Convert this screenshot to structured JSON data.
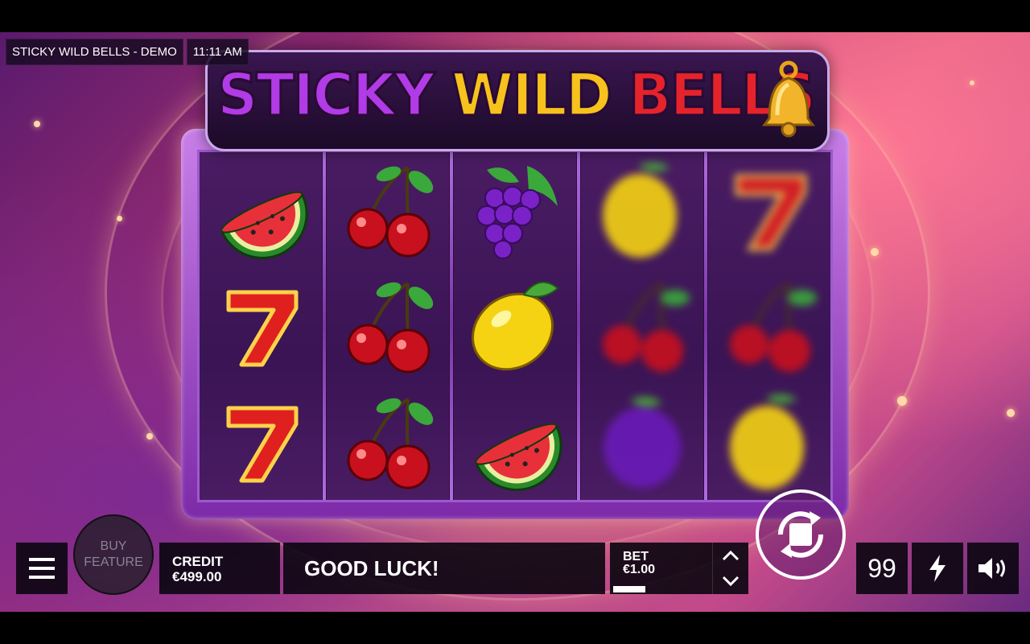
{
  "header": {
    "game_title": "STICKY WILD BELLS - DEMO",
    "clock": "11:11 AM"
  },
  "logo": {
    "word1": "STICKY",
    "word2": "WILD",
    "word3": "BELLS",
    "bell_icon": "bell-icon"
  },
  "reels": [
    {
      "state": "stopped",
      "symbols": [
        "watermelon",
        "seven",
        "seven"
      ]
    },
    {
      "state": "stopped",
      "symbols": [
        "cherries",
        "cherries",
        "cherries"
      ]
    },
    {
      "state": "stopped",
      "symbols": [
        "grapes",
        "lemon",
        "watermelon"
      ]
    },
    {
      "state": "spinning",
      "symbols": [
        "lemon",
        "cherries",
        "plum"
      ]
    },
    {
      "state": "spinning",
      "symbols": [
        "seven",
        "cherries",
        "lemon"
      ]
    }
  ],
  "controls": {
    "menu_icon": "hamburger-menu-icon",
    "buy_feature_label": "BUY FEATURE",
    "credit_label": "CREDIT",
    "credit_value": "€499.00",
    "message": "GOOD LUCK!",
    "bet_label": "BET",
    "bet_value": "€1.00",
    "bet_up_icon": "chevron-up-icon",
    "bet_down_icon": "chevron-down-icon",
    "spin_icon": "stop-spin-icon",
    "autoplay_count": "99",
    "turbo_icon": "lightning-icon",
    "sound_icon": "speaker-icon"
  },
  "colors": {
    "logo_purple": "#b13be6",
    "logo_gold": "#f7c21c",
    "logo_red": "#e5232b",
    "frame": "#9d5ad0"
  }
}
